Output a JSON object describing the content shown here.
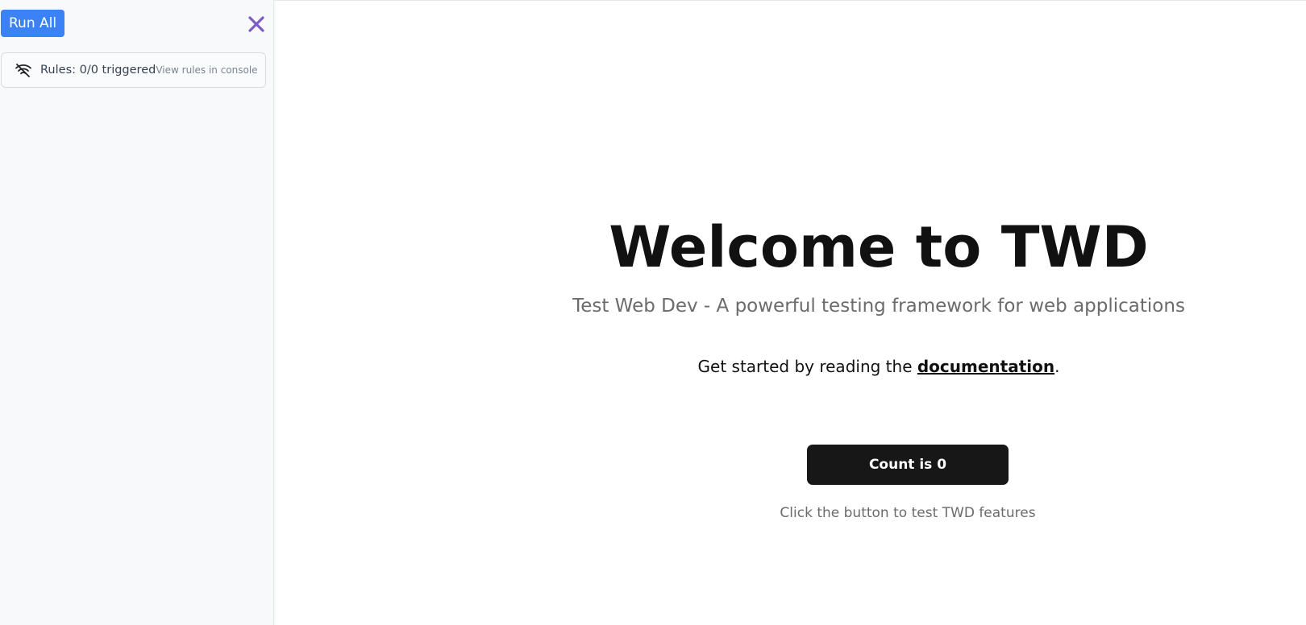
{
  "sidebar": {
    "run_all_label": "Run All",
    "close_icon": "close-x-icon",
    "accent_color": "#3b82f6",
    "close_color": "#7c5cc4",
    "rules": {
      "icon": "wifi-off-icon",
      "status": "Rules: 0/0 triggered",
      "link": "View rules in console"
    }
  },
  "main": {
    "title": "Welcome to TWD",
    "subtitle": "Test Web Dev - A powerful testing framework for web applications",
    "started_prefix": "Get started by reading the ",
    "doc_link": "documentation",
    "started_suffix": ".",
    "count_button": "Count is 0",
    "hint": "Click the button to test TWD features"
  }
}
